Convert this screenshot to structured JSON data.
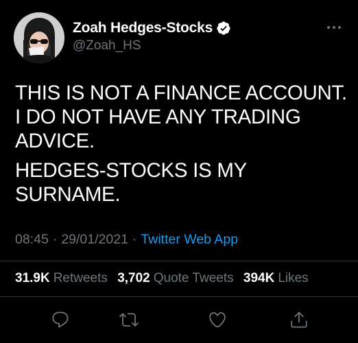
{
  "tweet": {
    "author": {
      "display_name": "Zoah Hedges-Stocks",
      "handle": "@Zoah_HS",
      "verified": true
    },
    "text_line_1": "THIS IS NOT A FINANCE ACCOUNT. I DO NOT HAVE ANY TRADING ADVICE.",
    "text_line_2": "HEDGES-STOCKS IS MY SURNAME.",
    "time": "08:45",
    "separator": "·",
    "date": "29/01/2021",
    "source": "Twitter Web App",
    "stats": {
      "retweets_count": "31.9K",
      "retweets_label": "Retweets",
      "quotes_count": "3,702",
      "quotes_label": "Quote Tweets",
      "likes_count": "394K",
      "likes_label": "Likes"
    }
  },
  "colors": {
    "background": "#000000",
    "primary_text": "#ffffff",
    "secondary_text": "#6e767d",
    "link": "#1d9bf0",
    "divider": "#2f3336",
    "verified_badge": "#ffffff"
  },
  "icons": [
    "verified-badge-icon",
    "more-icon",
    "reply-icon",
    "retweet-icon",
    "like-icon",
    "share-icon"
  ]
}
